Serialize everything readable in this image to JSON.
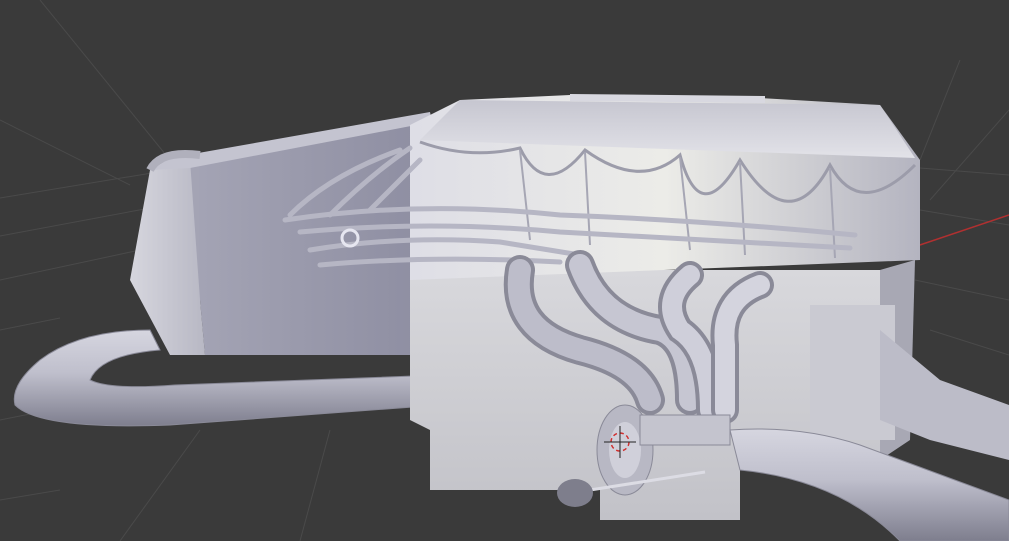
{
  "viewport": {
    "view": "3d-viewport",
    "background_color": "#3a3a3a",
    "grid_line_color": "#4a4a4a",
    "x_axis_color": "#b03030",
    "model_color": "#c8c8d4",
    "shadow_color": "#8a8a98",
    "cursor_icon": "3d-cursor-icon"
  }
}
